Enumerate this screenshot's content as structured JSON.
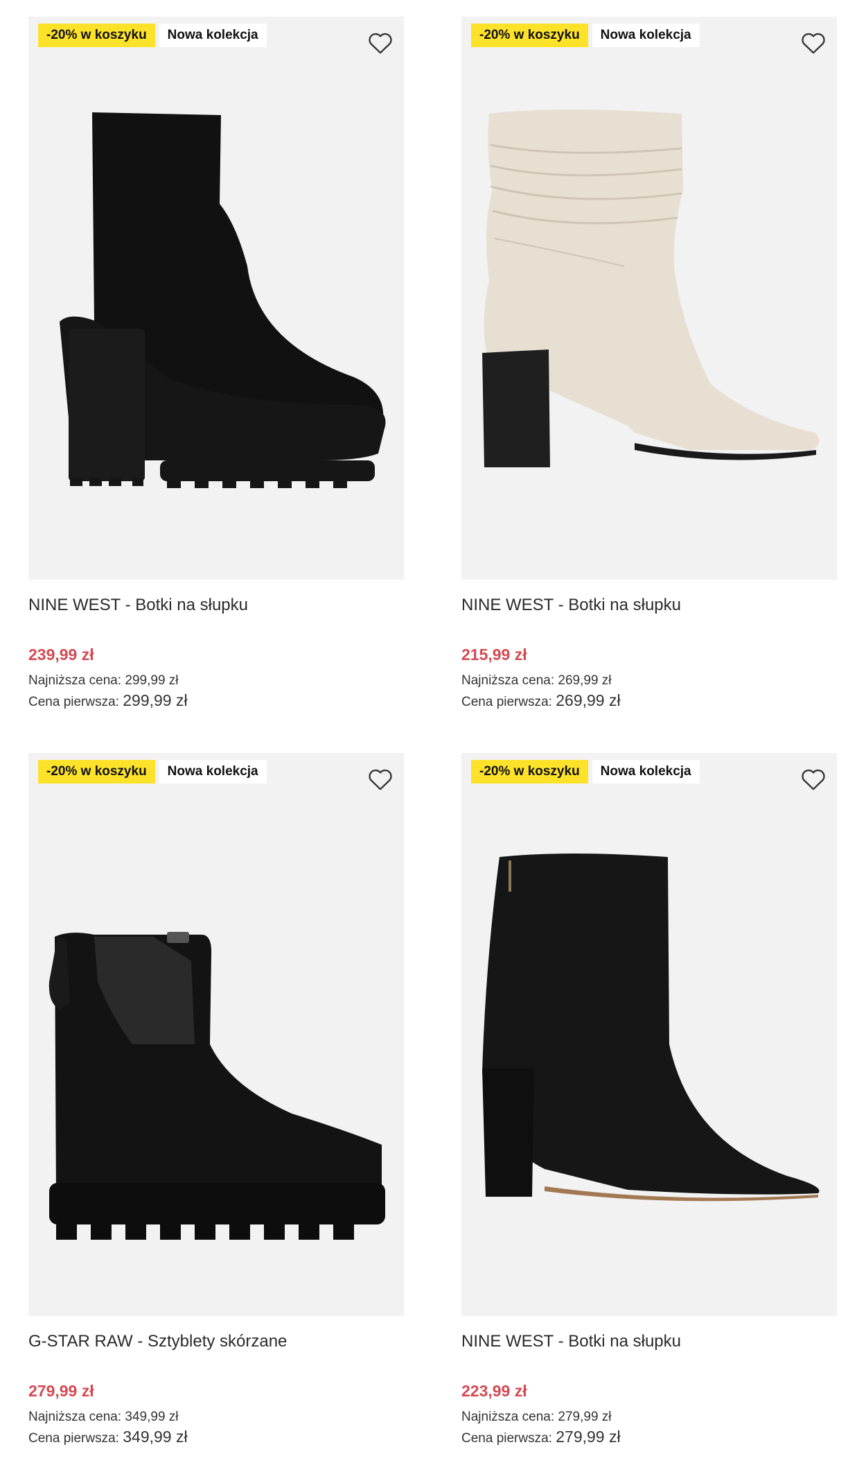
{
  "products": [
    {
      "badge_promo": "-20% w koszyku",
      "badge_new": "Nowa kolekcja",
      "title": "NINE WEST - Botki na słupku",
      "price": "239,99 zł",
      "lowest_label": "Najniższa cena:",
      "lowest_value": "299,99 zł",
      "first_label": "Cena pierwsza:",
      "first_value": "299,99 zł",
      "image": "black-suede-platform-heel-boot"
    },
    {
      "badge_promo": "-20% w koszyku",
      "badge_new": "Nowa kolekcja",
      "title": "NINE WEST - Botki na słupku",
      "price": "215,99 zł",
      "lowest_label": "Najniższa cena:",
      "lowest_value": "269,99 zł",
      "first_label": "Cena pierwsza:",
      "first_value": "269,99 zł",
      "image": "beige-slouch-heel-boot"
    },
    {
      "badge_promo": "-20% w koszyku",
      "badge_new": "Nowa kolekcja",
      "title": "G-STAR RAW - Sztyblety skórzane",
      "price": "279,99 zł",
      "lowest_label": "Najniższa cena:",
      "lowest_value": "349,99 zł",
      "first_label": "Cena pierwsza:",
      "first_value": "349,99 zł",
      "image": "black-leather-chelsea-boot"
    },
    {
      "badge_promo": "-20% w koszyku",
      "badge_new": "Nowa kolekcja",
      "title": "NINE WEST - Botki na słupku",
      "price": "223,99 zł",
      "lowest_label": "Najniższa cena:",
      "lowest_value": "279,99 zł",
      "first_label": "Cena pierwsza:",
      "first_value": "279,99 zł",
      "image": "black-leather-pointed-heel-boot"
    }
  ],
  "colors": {
    "promo_badge": "#fde22a",
    "price": "#d34a52",
    "image_bg": "#f2f2f2"
  },
  "icons": {
    "favorite": "heart-outline-icon"
  }
}
